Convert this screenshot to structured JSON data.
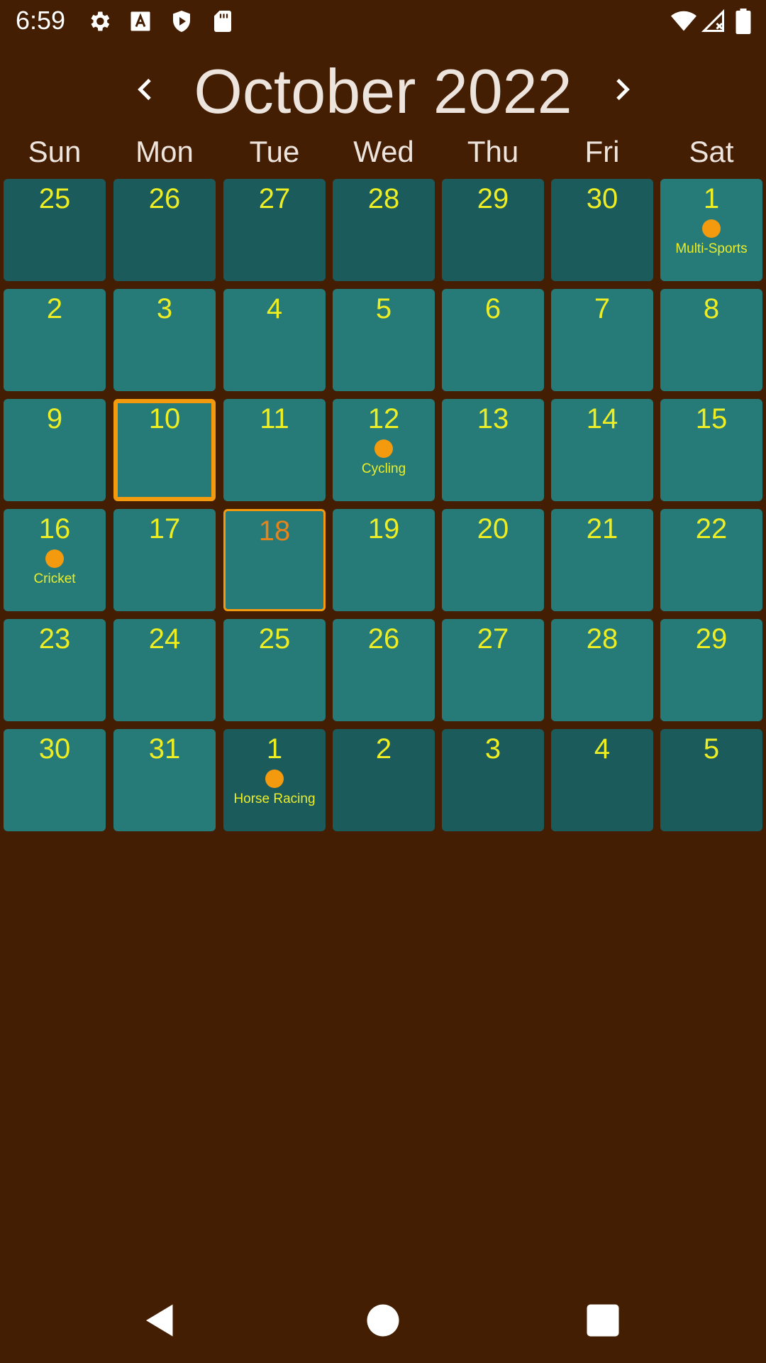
{
  "status_bar": {
    "time": "6:59",
    "icons": [
      "settings-icon",
      "font-icon",
      "shield-play-icon",
      "sd-card-icon",
      "wifi-icon",
      "signal-no-data-icon",
      "battery-icon"
    ]
  },
  "header": {
    "title": "October 2022",
    "prev_icon": "chevron-left-icon",
    "next_icon": "chevron-right-icon"
  },
  "weekdays": [
    "Sun",
    "Mon",
    "Tue",
    "Wed",
    "Thu",
    "Fri",
    "Sat"
  ],
  "colors": {
    "background": "#441e02",
    "cell": "#267a78",
    "cell_other_month": "#1c5b5b",
    "day_number": "#eded23",
    "accent": "#f39a0e",
    "header_text": "#ede4de"
  },
  "weeks": [
    [
      {
        "day": "25",
        "other": true
      },
      {
        "day": "26",
        "other": true
      },
      {
        "day": "27",
        "other": true
      },
      {
        "day": "28",
        "other": true
      },
      {
        "day": "29",
        "other": true
      },
      {
        "day": "30",
        "other": true
      },
      {
        "day": "1",
        "event": "Multi-Sports"
      }
    ],
    [
      {
        "day": "2"
      },
      {
        "day": "3"
      },
      {
        "day": "4"
      },
      {
        "day": "5"
      },
      {
        "day": "6"
      },
      {
        "day": "7"
      },
      {
        "day": "8"
      }
    ],
    [
      {
        "day": "9"
      },
      {
        "day": "10",
        "selected": true
      },
      {
        "day": "11"
      },
      {
        "day": "12",
        "event": "Cycling"
      },
      {
        "day": "13"
      },
      {
        "day": "14"
      },
      {
        "day": "15"
      }
    ],
    [
      {
        "day": "16",
        "event": "Cricket"
      },
      {
        "day": "17"
      },
      {
        "day": "18",
        "today": true
      },
      {
        "day": "19"
      },
      {
        "day": "20"
      },
      {
        "day": "21"
      },
      {
        "day": "22"
      }
    ],
    [
      {
        "day": "23"
      },
      {
        "day": "24"
      },
      {
        "day": "25"
      },
      {
        "day": "26"
      },
      {
        "day": "27"
      },
      {
        "day": "28"
      },
      {
        "day": "29"
      }
    ],
    [
      {
        "day": "30"
      },
      {
        "day": "31"
      },
      {
        "day": "1",
        "other": true,
        "event": "Horse Racing"
      },
      {
        "day": "2",
        "other": true
      },
      {
        "day": "3",
        "other": true
      },
      {
        "day": "4",
        "other": true
      },
      {
        "day": "5",
        "other": true
      }
    ]
  ],
  "nav_bar": {
    "icons": [
      "back-icon",
      "home-icon",
      "recents-icon"
    ]
  }
}
